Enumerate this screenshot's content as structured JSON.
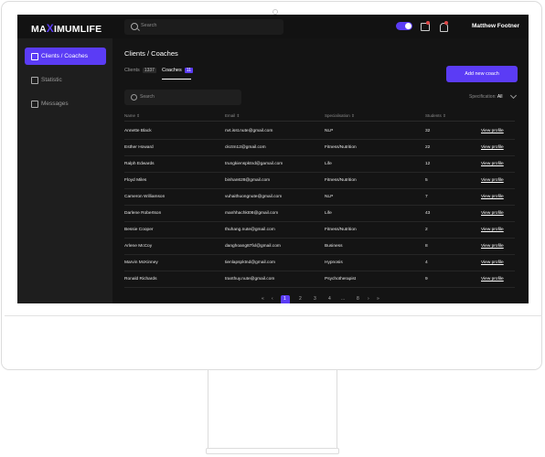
{
  "app": {
    "logo_pre": "MA",
    "logo_x": "X",
    "logo_post": "IMUMLIFE"
  },
  "topbar": {
    "search_placeholder": "Search",
    "user_name": "Matthew Footner"
  },
  "sidebar": {
    "items": [
      {
        "label": "Clients / Coaches",
        "icon": "users-icon",
        "active": true
      },
      {
        "label": "Statistic",
        "icon": "chart-icon",
        "active": false
      },
      {
        "label": "Messages",
        "icon": "message-icon",
        "active": false
      }
    ]
  },
  "main": {
    "title": "Clients / Coaches",
    "tabs": [
      {
        "label": "Clients",
        "count": "1337"
      },
      {
        "label": "Coaches",
        "count": "11"
      }
    ],
    "add_button": "Add new coach",
    "search_placeholder": "Search",
    "filter_label": "Specification:",
    "filter_value": "All",
    "columns": [
      "Name ⇕",
      "Email ⇕",
      "Specialisation ⇕",
      "Students ⇕"
    ],
    "rows": [
      {
        "name": "Annette Black",
        "email": "nvt.isst.nute@gmail.com",
        "spec": "NLP",
        "students": "32",
        "link": "View profile"
      },
      {
        "name": "Esther Howard",
        "email": "ckctm12@gmail.com",
        "spec": "Fitness/Nutrition",
        "students": "22",
        "link": "View profile"
      },
      {
        "name": "Ralph Edwards",
        "email": "trungkienspktnd@gamail.com",
        "spec": "Life",
        "students": "12",
        "link": "View profile"
      },
      {
        "name": "Floyd Miles",
        "email": "binhan628@gmail.com",
        "spec": "Fitness/Nutrition",
        "students": "5",
        "link": "View profile"
      },
      {
        "name": "Cameron Williamson",
        "email": "vuhaithuongnute@gmail.com",
        "spec": "NLP",
        "students": "7",
        "link": "View profile"
      },
      {
        "name": "Darlene Robertson",
        "email": "manhhachkt08@gmail.com",
        "spec": "Life",
        "students": "43",
        "link": "View profile"
      },
      {
        "name": "Bessie Cooper",
        "email": "thuhang.nute@gmail.com",
        "spec": "Fitness/Nutrition",
        "students": "2",
        "link": "View profile"
      },
      {
        "name": "Arlene McCoy",
        "email": "danghoang87fxl@gmail.com",
        "spec": "Business",
        "students": "8",
        "link": "View profile"
      },
      {
        "name": "Marvin McKinney",
        "email": "tienlapspktnd@gmail.com",
        "spec": "Hypnosis",
        "students": "4",
        "link": "View profile"
      },
      {
        "name": "Ronald Richards",
        "email": "tranthuy.nute@gmail.com",
        "spec": "Psychotherapist",
        "students": "9",
        "link": "View profile"
      }
    ],
    "pagination": {
      "pages": [
        "1",
        "2",
        "3",
        "4",
        "...",
        "8"
      ],
      "active_page": "1"
    }
  },
  "colors": {
    "accent": "#5b3cf5",
    "background": "#141414",
    "sidebar": "#1e1e1e"
  }
}
